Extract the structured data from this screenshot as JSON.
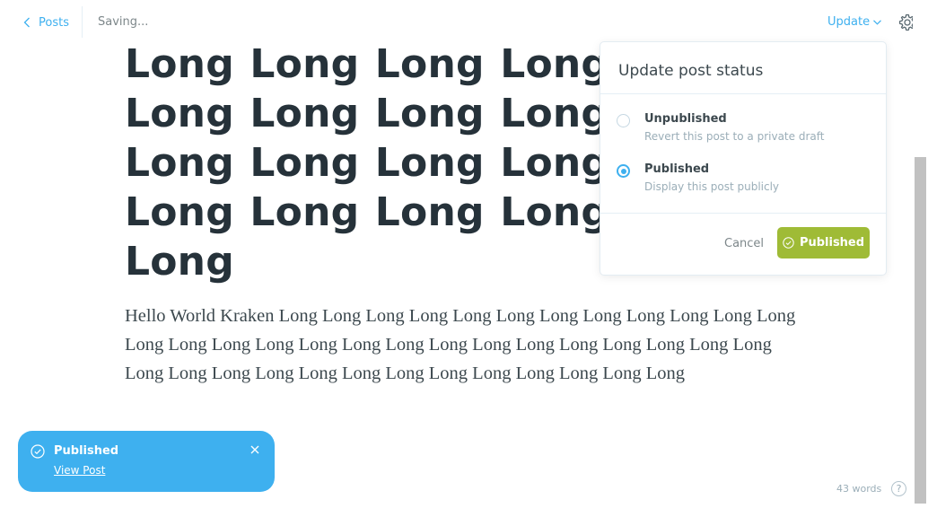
{
  "header": {
    "back_label": "Posts",
    "status": "Saving...",
    "update_label": "Update"
  },
  "editor": {
    "title": "Long Long Long Long Long Long Long Long Long Long Long Long Long Long Long Long Long Long Long Long Long",
    "body": "Hello World Kraken Long Long Long Long Long Long Long Long Long Long Long Long Long Long Long Long Long Long Long Long Long Long Long Long Long Long Long Long Long Long Long Long Long Long Long Long Long Long Long Long"
  },
  "publish_menu": {
    "title": "Update post status",
    "options": [
      {
        "label": "Unpublished",
        "description": "Revert this post to a private draft",
        "selected": false
      },
      {
        "label": "Published",
        "description": "Display this post publicly",
        "selected": true
      }
    ],
    "cancel_label": "Cancel",
    "confirm_label": "Published"
  },
  "toast": {
    "title": "Published",
    "link_label": "View Post"
  },
  "footer": {
    "word_count": "43 words",
    "help_label": "?"
  },
  "colors": {
    "accent": "#3eb0ef",
    "success": "#9fbb36",
    "text": "#26323a"
  }
}
